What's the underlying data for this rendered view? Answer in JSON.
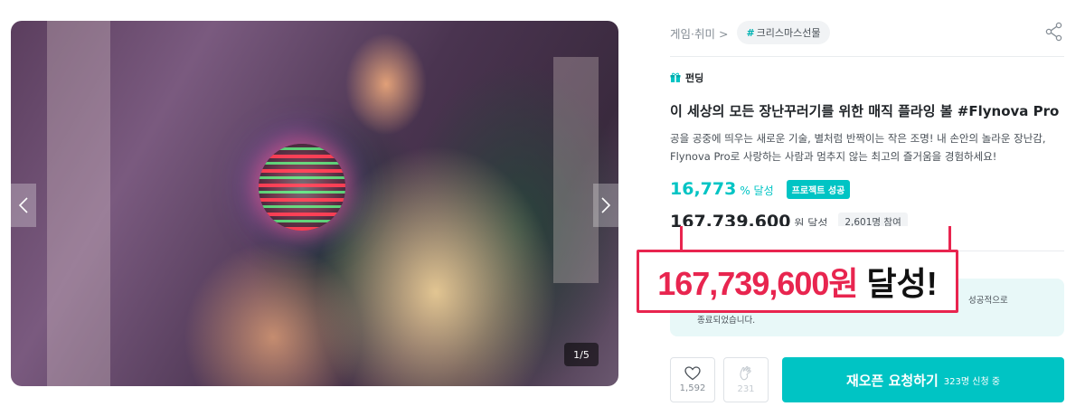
{
  "gallery": {
    "counter": "1/5",
    "prev_icon": "chevron-left-icon",
    "next_icon": "chevron-right-icon"
  },
  "breadcrumb": {
    "category": "게임·취미",
    "separator": ">",
    "tag_hash": "#",
    "tag": "크리스마스선물"
  },
  "share_icon": "share-icon",
  "funding_label": "펀딩",
  "title": "이 세상의 모든 장난꾸러기를 위한 매직 플라잉 볼 #Flynova Pro",
  "description": {
    "line1": "공을 공중에 띄우는 새로운 기술, 별처럼 반짝이는 작은 조명! 내 손안의 놀라운 장난감,",
    "line2": "Flynova Pro로 사랑하는 사람과 멈추지 않는 최고의 즐거움을 경험하세요!"
  },
  "achievement": {
    "rate": "16,773",
    "rate_unit": "% 달성",
    "status_badge": "프로젝트 성공",
    "amount": "167,739,600",
    "amount_unit": "원 달성",
    "supporters": "2,601명 참여"
  },
  "notice": {
    "line1": "성공적으로",
    "line2": "종료되었습니다."
  },
  "actions": {
    "like_count": "1,592",
    "alarm_count": "231",
    "reopen_label": "재오픈 요청하기",
    "reopen_sub": "323명 신청 중"
  },
  "callout": {
    "highlight": "167,739,600원",
    "rest": "달성!"
  },
  "colors": {
    "accent": "#00c4c4",
    "callout": "#e8254f"
  }
}
